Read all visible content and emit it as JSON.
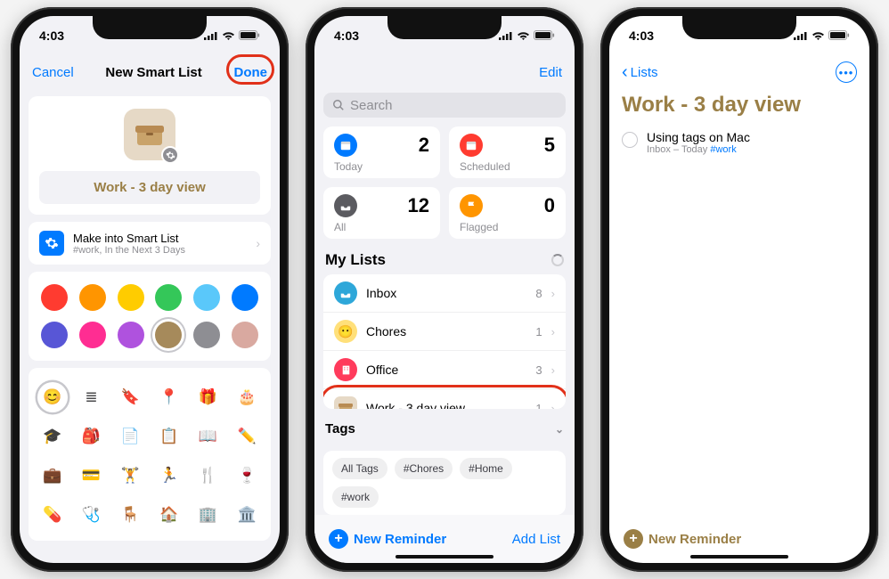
{
  "status": {
    "time": "4:03"
  },
  "s1": {
    "cancel": "Cancel",
    "title": "New Smart List",
    "done": "Done",
    "list_name": "Work - 3 day view",
    "smart": {
      "title": "Make into Smart List",
      "subtitle": "#work, In the Next 3 Days"
    },
    "colors": [
      "#ff3b30",
      "#ff9500",
      "#ffcc00",
      "#34c759",
      "#5ac8fa",
      "#007aff",
      "#5856d6",
      "#ff2d92",
      "#af52de",
      "#a68a5b",
      "#8e8e93",
      "#d9a9a0"
    ],
    "selected_color_index": 9,
    "icons": [
      "😊",
      "≣",
      "🔖",
      "📍",
      "🎁",
      "🎂",
      "🎓",
      "🎒",
      "📄",
      "📋",
      "📖",
      "✏️",
      "💼",
      "💳",
      "🏋️",
      "🏃",
      "🍴",
      "🍷",
      "💊",
      "🩺",
      "🪑",
      "🏠",
      "🏢",
      "🏛️"
    ],
    "selected_icon_index": 0
  },
  "s2": {
    "edit": "Edit",
    "search_ph": "Search",
    "tiles": [
      {
        "label": "Today",
        "count": "2",
        "color": "#007aff",
        "icon": "calendar"
      },
      {
        "label": "Scheduled",
        "count": "5",
        "color": "#ff3b30",
        "icon": "calendar"
      },
      {
        "label": "All",
        "count": "12",
        "color": "#5b5b60",
        "icon": "tray"
      },
      {
        "label": "Flagged",
        "count": "0",
        "color": "#ff9500",
        "icon": "flag"
      }
    ],
    "my_lists": "My Lists",
    "lists": [
      {
        "name": "Inbox",
        "count": "8",
        "color": "#2ea7d9",
        "glyph": "tray"
      },
      {
        "name": "Chores",
        "count": "1",
        "color": "#ffe07a",
        "glyph": "emoji"
      },
      {
        "name": "Office",
        "count": "3",
        "color": "#ff3b5c",
        "glyph": "building"
      },
      {
        "name": "Work - 3 day view",
        "count": "1",
        "color": "#e6d9c6",
        "glyph": "box",
        "highlight": true
      }
    ],
    "tags_h": "Tags",
    "tags": [
      "All Tags",
      "#Chores",
      "#Home",
      "#work"
    ],
    "new_reminder": "New Reminder",
    "add_list": "Add List"
  },
  "s3": {
    "back": "Lists",
    "title": "Work - 3 day view",
    "item": {
      "title": "Using tags on Mac",
      "sub_pre": "Inbox – Today ",
      "sub_tag": "#work"
    },
    "new_reminder": "New Reminder"
  }
}
